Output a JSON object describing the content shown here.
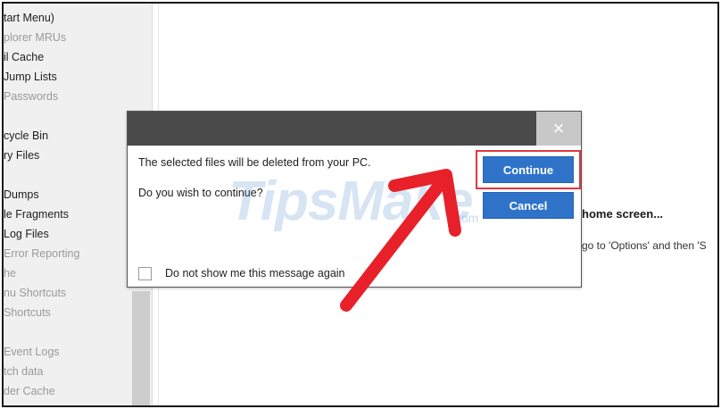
{
  "left_panel": {
    "items": [
      {
        "label": "tart Menu)",
        "style": "dark"
      },
      {
        "label": "plorer MRUs",
        "style": "grey"
      },
      {
        "label": "il Cache",
        "style": "dark"
      },
      {
        "label": "Jump Lists",
        "style": "dark"
      },
      {
        "label": "Passwords",
        "style": "grey"
      },
      {
        "label": "",
        "style": "dark"
      },
      {
        "label": "cycle Bin",
        "style": "dark"
      },
      {
        "label": "ry Files",
        "style": "dark"
      },
      {
        "label": "",
        "style": "dark"
      },
      {
        "label": "Dumps",
        "style": "dark"
      },
      {
        "label": "le Fragments",
        "style": "dark"
      },
      {
        "label": "Log Files",
        "style": "dark"
      },
      {
        "label": "Error Reporting",
        "style": "grey"
      },
      {
        "label": "he",
        "style": "grey"
      },
      {
        "label": "nu Shortcuts",
        "style": "grey"
      },
      {
        "label": "Shortcuts",
        "style": "grey"
      },
      {
        "label": "",
        "style": "dark"
      },
      {
        "label": "Event Logs",
        "style": "grey"
      },
      {
        "label": "tch data",
        "style": "grey"
      },
      {
        "label": "der Cache",
        "style": "grey"
      }
    ]
  },
  "background": {
    "heading": "home screen...",
    "text": "go to 'Options' and then 'S"
  },
  "dialog": {
    "close_glyph": "×",
    "message": "The selected files will be deleted from your PC.",
    "question": "Do you wish to continue?",
    "continue_label": "Continue",
    "cancel_label": "Cancel",
    "checkbox_label": "Do not show me this message again"
  },
  "watermark": {
    "text": "TipsMake",
    "suffix": ".com"
  },
  "colors": {
    "button_blue": "#2f73c9",
    "highlight_red": "#e0383e",
    "arrow_red": "#e8202a",
    "titlebar": "#4a4a4a"
  }
}
